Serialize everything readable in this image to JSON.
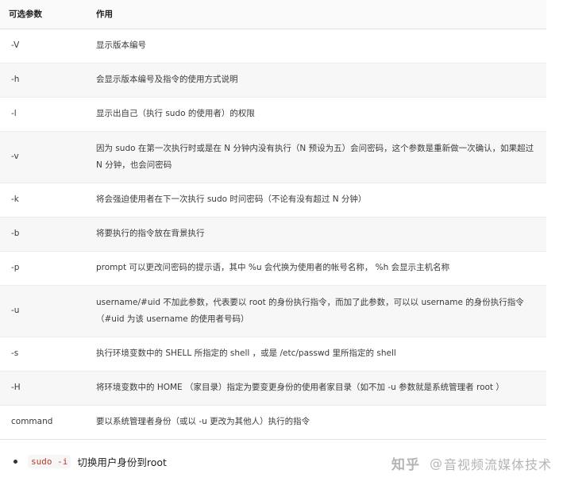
{
  "table": {
    "headers": [
      "可选参数",
      "作用"
    ],
    "rows": [
      {
        "opt": "-V",
        "desc": "显示版本编号"
      },
      {
        "opt": "-h",
        "desc": "会显示版本编号及指令的使用方式说明"
      },
      {
        "opt": "-l",
        "desc": "显示出自己（执行 sudo 的使用者）的权限"
      },
      {
        "opt": "-v",
        "desc": "因为 sudo 在第一次执行时或是在 N 分钟内没有执行（N 预设为五）会问密码，这个参数是重新做一次确认，如果超过 N 分钟，也会问密码"
      },
      {
        "opt": "-k",
        "desc": "将会强迫使用者在下一次执行 sudo 时问密码（不论有没有超过 N 分钟）"
      },
      {
        "opt": "-b",
        "desc": "将要执行的指令放在背景执行"
      },
      {
        "opt": "-p",
        "desc": "prompt 可以更改问密码的提示语，其中 %u 会代换为使用者的帐号名称， %h 会显示主机名称"
      },
      {
        "opt": "-u",
        "desc": "username/#uid 不加此参数，代表要以 root 的身份执行指令，而加了此参数，可以以 username 的身份执行指令（#uid 为该 username 的使用者号码）"
      },
      {
        "opt": "-s",
        "desc": "执行环境变数中的 SHELL 所指定的 shell ，或是 /etc/passwd 里所指定的 shell"
      },
      {
        "opt": "-H",
        "desc": "将环境变数中的 HOME （家目录）指定为要变更身份的使用者家目录（如不加 -u 参数就是系统管理者 root ）"
      },
      {
        "opt": "command",
        "desc": "要以系统管理者身份（或以 -u 更改为其他人）执行的指令"
      }
    ]
  },
  "bullet": {
    "code": "sudo -i",
    "text": "切换用户身份到root"
  },
  "watermark": {
    "brand": "知乎",
    "at": "@",
    "author": "音视频流媒体技术"
  }
}
